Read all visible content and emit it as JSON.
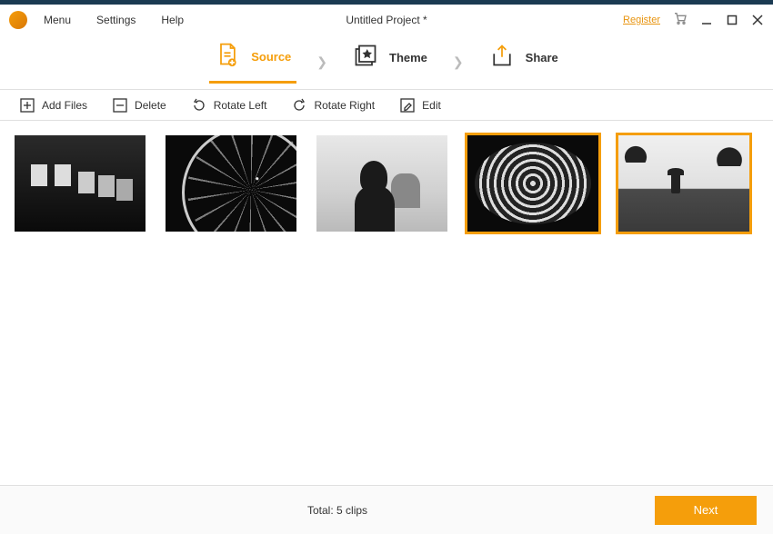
{
  "menubar": {
    "menu": "Menu",
    "settings": "Settings",
    "help": "Help",
    "project_title": "Untitled Project *",
    "register": "Register"
  },
  "steps": {
    "source": "Source",
    "theme": "Theme",
    "share": "Share"
  },
  "toolbar": {
    "add_files": "Add Files",
    "delete": "Delete",
    "rotate_left": "Rotate Left",
    "rotate_right": "Rotate Right",
    "edit": "Edit"
  },
  "footer": {
    "total": "Total: 5 clips",
    "next": "Next"
  },
  "thumbnails": {
    "count": 5,
    "selected_indices": [
      3,
      4
    ]
  },
  "colors": {
    "accent": "#f59e0b"
  }
}
